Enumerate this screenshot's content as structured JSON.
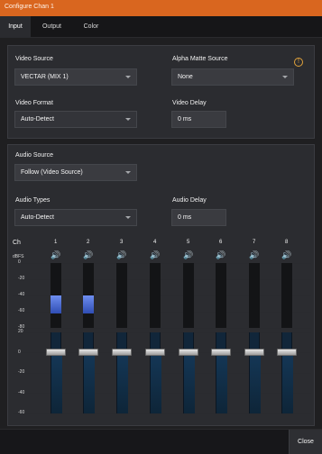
{
  "window": {
    "title": "Configure Chan 1"
  },
  "tabs": [
    {
      "label": "Input",
      "active": true
    },
    {
      "label": "Output",
      "active": false
    },
    {
      "label": "Color",
      "active": false
    }
  ],
  "video": {
    "source_label": "Video Source",
    "source_value": "VECTAR (MIX 1)",
    "alpha_label": "Alpha Matte Source",
    "alpha_value": "None",
    "format_label": "Video Format",
    "format_value": "Auto-Detect",
    "delay_label": "Video Delay",
    "delay_value": "0 ms"
  },
  "audio": {
    "source_label": "Audio Source",
    "source_value": "Follow (Video Source)",
    "types_label": "Audio Types",
    "types_value": "Auto-Detect",
    "delay_label": "Audio Delay",
    "delay_value": "0 ms"
  },
  "mixer": {
    "ch_label": "Ch",
    "unit_label": "dBFS",
    "channels": [
      "1",
      "2",
      "3",
      "4",
      "5",
      "6",
      "7",
      "8"
    ],
    "meter_levels": [
      0.5,
      0.5,
      0,
      0,
      0,
      0,
      0,
      0
    ],
    "meter_scale": [
      "0",
      "-20",
      "-40",
      "-60",
      "-80"
    ],
    "fader_scale": [
      "20",
      "0",
      "-20",
      "-40",
      "-60"
    ],
    "fader_values_db": [
      0,
      0,
      0,
      0,
      0,
      0,
      0,
      0
    ]
  },
  "footer": {
    "close_label": "Close"
  },
  "colors": {
    "accent": "#d9661f",
    "meter": "#4a6ee0",
    "warning": "#e2a33b"
  }
}
